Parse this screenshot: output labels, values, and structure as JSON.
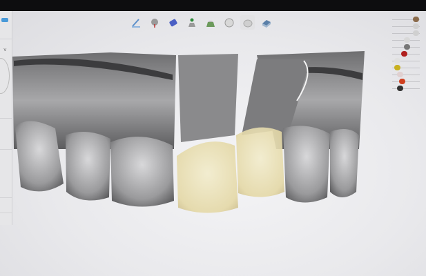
{
  "toolbar": {
    "tools": [
      {
        "icon": "margin-line-icon",
        "color": "#5b8fc9"
      },
      {
        "icon": "insertion-axis-icon",
        "color": "#8a8a8a"
      },
      {
        "icon": "cement-gap-icon",
        "color": "#4a5fc4"
      },
      {
        "icon": "crown-placement-icon",
        "color": "#2f8a3c"
      },
      {
        "icon": "adaptation-icon",
        "color": "#6c9a5c"
      },
      {
        "icon": "tooth-shape-icon",
        "color": "#d8d8d8"
      },
      {
        "icon": "tooth-gray-icon",
        "color": "#cfcfcf"
      },
      {
        "icon": "base-plate-icon",
        "color": "#5a7fa8"
      }
    ]
  },
  "visibility_panel": {
    "layers": [
      {
        "icon": "antagonist-icon",
        "color": "#8a6a4a",
        "opacity": 0.9
      },
      {
        "icon": "tooth-icon",
        "color": "#d0d0d0",
        "opacity": 0.9
      },
      {
        "icon": "crown-icon",
        "color": "#d0d0d0",
        "opacity": 0.9
      },
      {
        "icon": "tooth-icon",
        "color": "#d8d8d8",
        "opacity": 0.5
      },
      {
        "icon": "tool-icon",
        "color": "#777777",
        "opacity": 0.5
      },
      {
        "icon": "jaw-red-icon",
        "color": "#b02020",
        "opacity": 0.4
      },
      {
        "icon": "tooth-icon",
        "color": "#e0e0e0",
        "opacity": 0.1
      },
      {
        "icon": "gingiva-icon",
        "color": "#c8b020",
        "opacity": 0.1
      },
      {
        "icon": "tooth-icon",
        "color": "#e0d0d0",
        "opacity": 0.2
      },
      {
        "icon": "crown-color-icon",
        "color": "#d04020",
        "opacity": 0.3
      },
      {
        "icon": "implant-icon",
        "color": "#333333",
        "opacity": 0.2
      }
    ]
  },
  "colors": {
    "accent": "#4a7fc0",
    "crown": "#ece3b4",
    "model": "#8e8e90"
  }
}
